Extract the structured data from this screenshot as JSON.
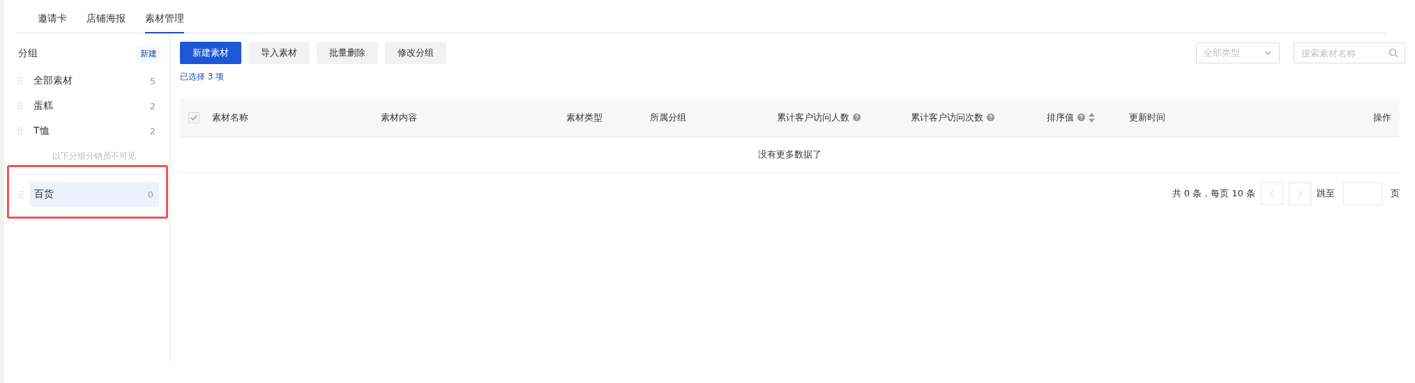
{
  "tabs": [
    {
      "label": "邀请卡",
      "selected": false
    },
    {
      "label": "店铺海报",
      "selected": false
    },
    {
      "label": "素材管理",
      "selected": true
    }
  ],
  "sidebar": {
    "title": "分组",
    "new_button": "新建",
    "items": [
      {
        "label": "全部素材",
        "count": "5",
        "selected": false
      },
      {
        "label": "蛋糕",
        "count": "2",
        "selected": false
      },
      {
        "label": "T恤",
        "count": "2",
        "selected": false
      }
    ],
    "hidden_hint": "以下分组分销员不可见",
    "hidden_items": [
      {
        "label": "百货",
        "count": "0",
        "selected": true
      }
    ],
    "highlighted": true
  },
  "toolbar": {
    "buttons": [
      {
        "label": "新建素材",
        "kind": "primary"
      },
      {
        "label": "导入素材",
        "kind": "default"
      },
      {
        "label": "批量删除",
        "kind": "default"
      },
      {
        "label": "修改分组",
        "kind": "default"
      }
    ],
    "selection_note": "已选择 3 项",
    "type_filter": {
      "placeholder": "全部类型"
    },
    "search": {
      "placeholder": "搜索素材名称"
    }
  },
  "table": {
    "select_all": {
      "checked": true,
      "disabled": true
    },
    "columns": [
      {
        "label": "素材名称",
        "help": false,
        "sortable": false
      },
      {
        "label": "素材内容",
        "help": false,
        "sortable": false
      },
      {
        "label": "素材类型",
        "help": false,
        "sortable": false
      },
      {
        "label": "所属分组",
        "help": false,
        "sortable": false
      },
      {
        "label": "累计客户访问人数",
        "help": true,
        "sortable": false
      },
      {
        "label": "累计客户访问次数",
        "help": true,
        "sortable": false
      },
      {
        "label": "排序值",
        "help": true,
        "sortable": true
      },
      {
        "label": "更新时间",
        "help": false,
        "sortable": false
      },
      {
        "label": "操作",
        "help": false,
        "sortable": false
      }
    ],
    "empty_text": "没有更多数据了"
  },
  "pagination": {
    "summary": "共 0 条，每页 10 条",
    "jump_label": "跳至",
    "page_suffix": "页"
  }
}
